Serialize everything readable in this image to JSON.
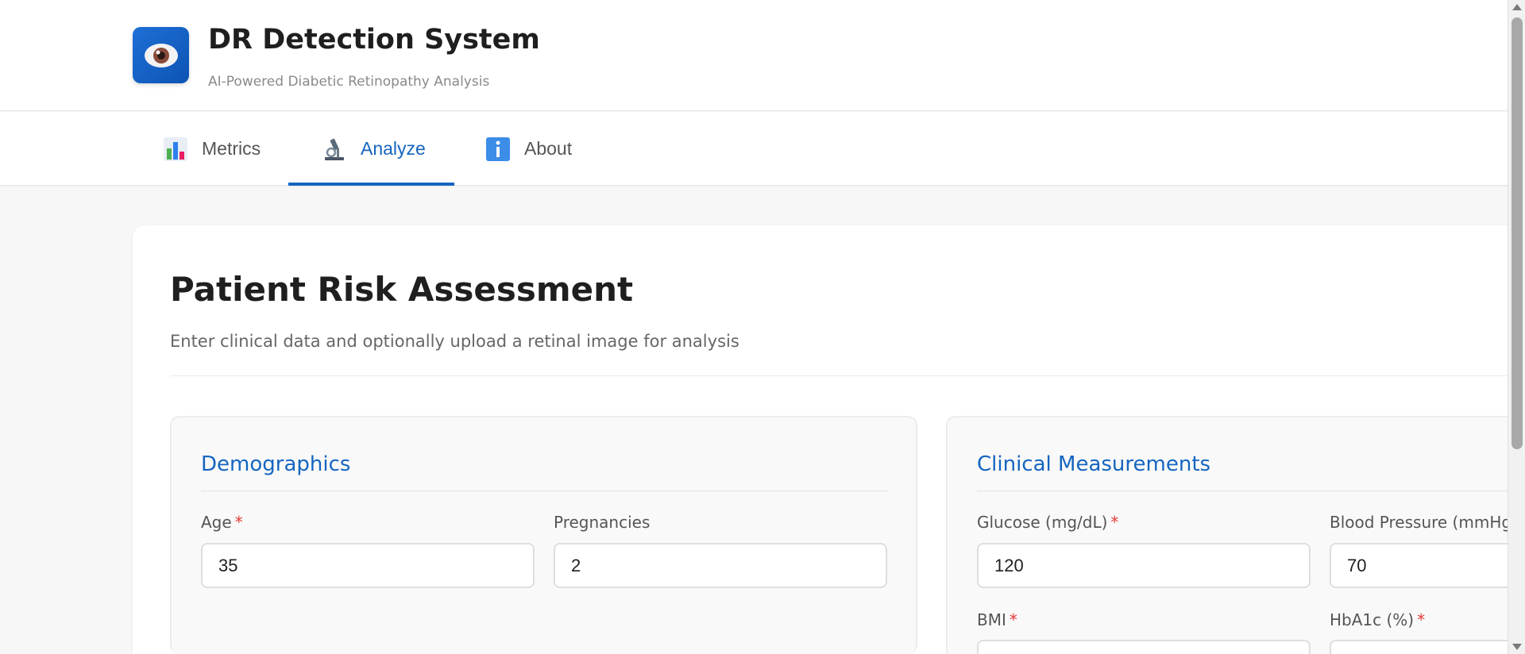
{
  "header": {
    "title": "DR Detection System",
    "subtitle": "AI-Powered Diabetic Retinopathy Analysis",
    "logo_icon": "eye-icon"
  },
  "nav": {
    "tabs": [
      {
        "label": "Metrics",
        "icon": "bar-chart-icon",
        "active": false
      },
      {
        "label": "Analyze",
        "icon": "microscope-icon",
        "active": true
      },
      {
        "label": "About",
        "icon": "info-icon",
        "active": false
      }
    ]
  },
  "main": {
    "title": "Patient Risk Assessment",
    "description": "Enter clinical data and optionally upload a retinal image for analysis",
    "required_marker": "*",
    "demographics": {
      "title": "Demographics",
      "fields": [
        {
          "label": "Age",
          "value": "35",
          "required": true
        },
        {
          "label": "Pregnancies",
          "value": "2",
          "required": false
        }
      ]
    },
    "clinical": {
      "title": "Clinical Measurements",
      "fields": [
        {
          "label": "Glucose (mg/dL)",
          "value": "120",
          "required": true
        },
        {
          "label": "Blood Pressure (mmHg)",
          "value": "70",
          "required": false
        },
        {
          "label": "BMI",
          "value": "",
          "required": true
        },
        {
          "label": "HbA1c (%)",
          "value": "",
          "required": true
        }
      ]
    }
  },
  "colors": {
    "accent": "#1565c0",
    "required": "#e53935",
    "logo_bg": "#1565c0"
  }
}
